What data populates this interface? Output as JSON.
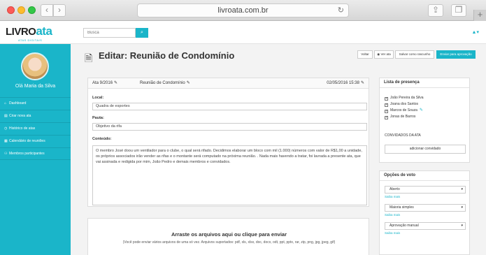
{
  "browser": {
    "url": "livroata.com.br",
    "back_icon": "‹",
    "forward_icon": "›",
    "new_tab_icon": "+"
  },
  "header": {
    "logo_prefix": "LIVRO",
    "logo_suffix": "ata",
    "logo_tagline": "ATAS DIGITAIS",
    "search_placeholder": "Busca",
    "search_icon": "search-icon",
    "user_menu": "▲▾"
  },
  "sidebar": {
    "greeting": "Olá",
    "user_name": "Maria da Silva",
    "items": [
      {
        "label": "Dashboard",
        "icon": "⌂"
      },
      {
        "label": "Criar nova ata",
        "icon": "▤"
      },
      {
        "label": "Histórico de atas",
        "icon": "◷"
      },
      {
        "label": "Calendário de reuniões",
        "icon": "▦"
      },
      {
        "label": "Membros participantes",
        "icon": "⚇"
      }
    ]
  },
  "page": {
    "title": "Editar: Reunião de Condomínio",
    "buttons": {
      "voltar": "Voltar",
      "ver_ata": "Ver ata",
      "salvar": "Salvar como rascunho",
      "enviar": "Enviar para aprovação"
    }
  },
  "form": {
    "ata_number": "Ata  9/2016",
    "subject": "Reunião de Condomínio",
    "datetime": "02/05/2016 15:38",
    "local_label": "Local:",
    "local_value": "Quadra de esportes",
    "pauta_label": "Pauta:",
    "pauta_value": "Objetivo da rifa",
    "conteudo_label": "Conteúdo:",
    "conteudo_value": "O membro José doou um ventilador para o clube, o qual será rifado. Decidimos elaborar um bloco com mil (1.000) números com valor de R$1,00 a unidade, os próprios associados irão vender as rifas e o montante será computado na próxima reunião. . Nada mais havendo a tratar, foi lavrada a presente ata, que vai assinada e redigida por mim, João Pedro e demais membros e convidados."
  },
  "upload": {
    "title": "Arraste os arquivos aqui ou clique para enviar",
    "subtitle": "(Você pode enviar vários arquivos de uma só vez. Arquivos suportados: pdf, xls, xlsx, doc, docx, odt, ppt, pptx, rar, zip, png, jpg, jpeg, gif)"
  },
  "presence": {
    "title": "Lista de presença",
    "members": [
      {
        "name": "João Pereira da Silva",
        "checked": true
      },
      {
        "name": "Joana dos Santos",
        "checked": true
      },
      {
        "name": "Marcos de Souza",
        "checked": true
      },
      {
        "name": "Jonas de Barros",
        "checked": true
      }
    ],
    "guests_label": "CONVIDADOS DA ATA",
    "add_guest": "adicionar convidado"
  },
  "voting": {
    "title": "Opções de voto",
    "options": [
      {
        "value": "Aberto",
        "link": "Saiba mais"
      },
      {
        "value": "Maioria simples",
        "link": "Saiba mais"
      },
      {
        "value": "Aprovação manual",
        "link": "Saiba mais"
      }
    ]
  },
  "colors": {
    "accent": "#1ab5c9",
    "sidebar_bg": "#1ab5c9",
    "main_bg": "#f3f3f3"
  }
}
